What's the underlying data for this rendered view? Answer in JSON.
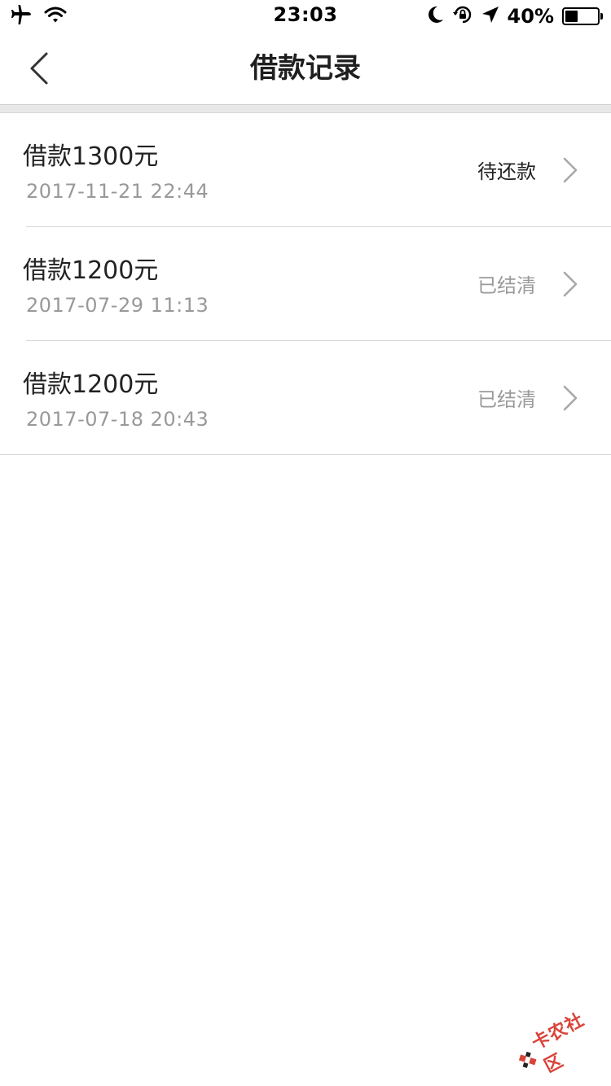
{
  "status_bar": {
    "time": "23:03",
    "battery_percent": "40%",
    "battery_level": 0.4,
    "icons": [
      "airplane-icon",
      "wifi-icon",
      "moon-icon",
      "rotation-lock-icon",
      "location-arrow-icon",
      "battery-icon"
    ]
  },
  "nav": {
    "title": "借款记录",
    "back_icon": "chevron-left-icon"
  },
  "loans": [
    {
      "title": "借款1300元",
      "date": "2017-11-21 22:44",
      "status": "待还款",
      "status_color": "#222222"
    },
    {
      "title": "借款1200元",
      "date": "2017-07-29 11:13",
      "status": "已结清",
      "status_color": "#9a9a9a"
    },
    {
      "title": "借款1200元",
      "date": "2017-07-18 20:43",
      "status": "已结清",
      "status_color": "#9a9a9a"
    }
  ],
  "watermark": {
    "text": "卡农社区",
    "accent_color": "#d9443a"
  }
}
